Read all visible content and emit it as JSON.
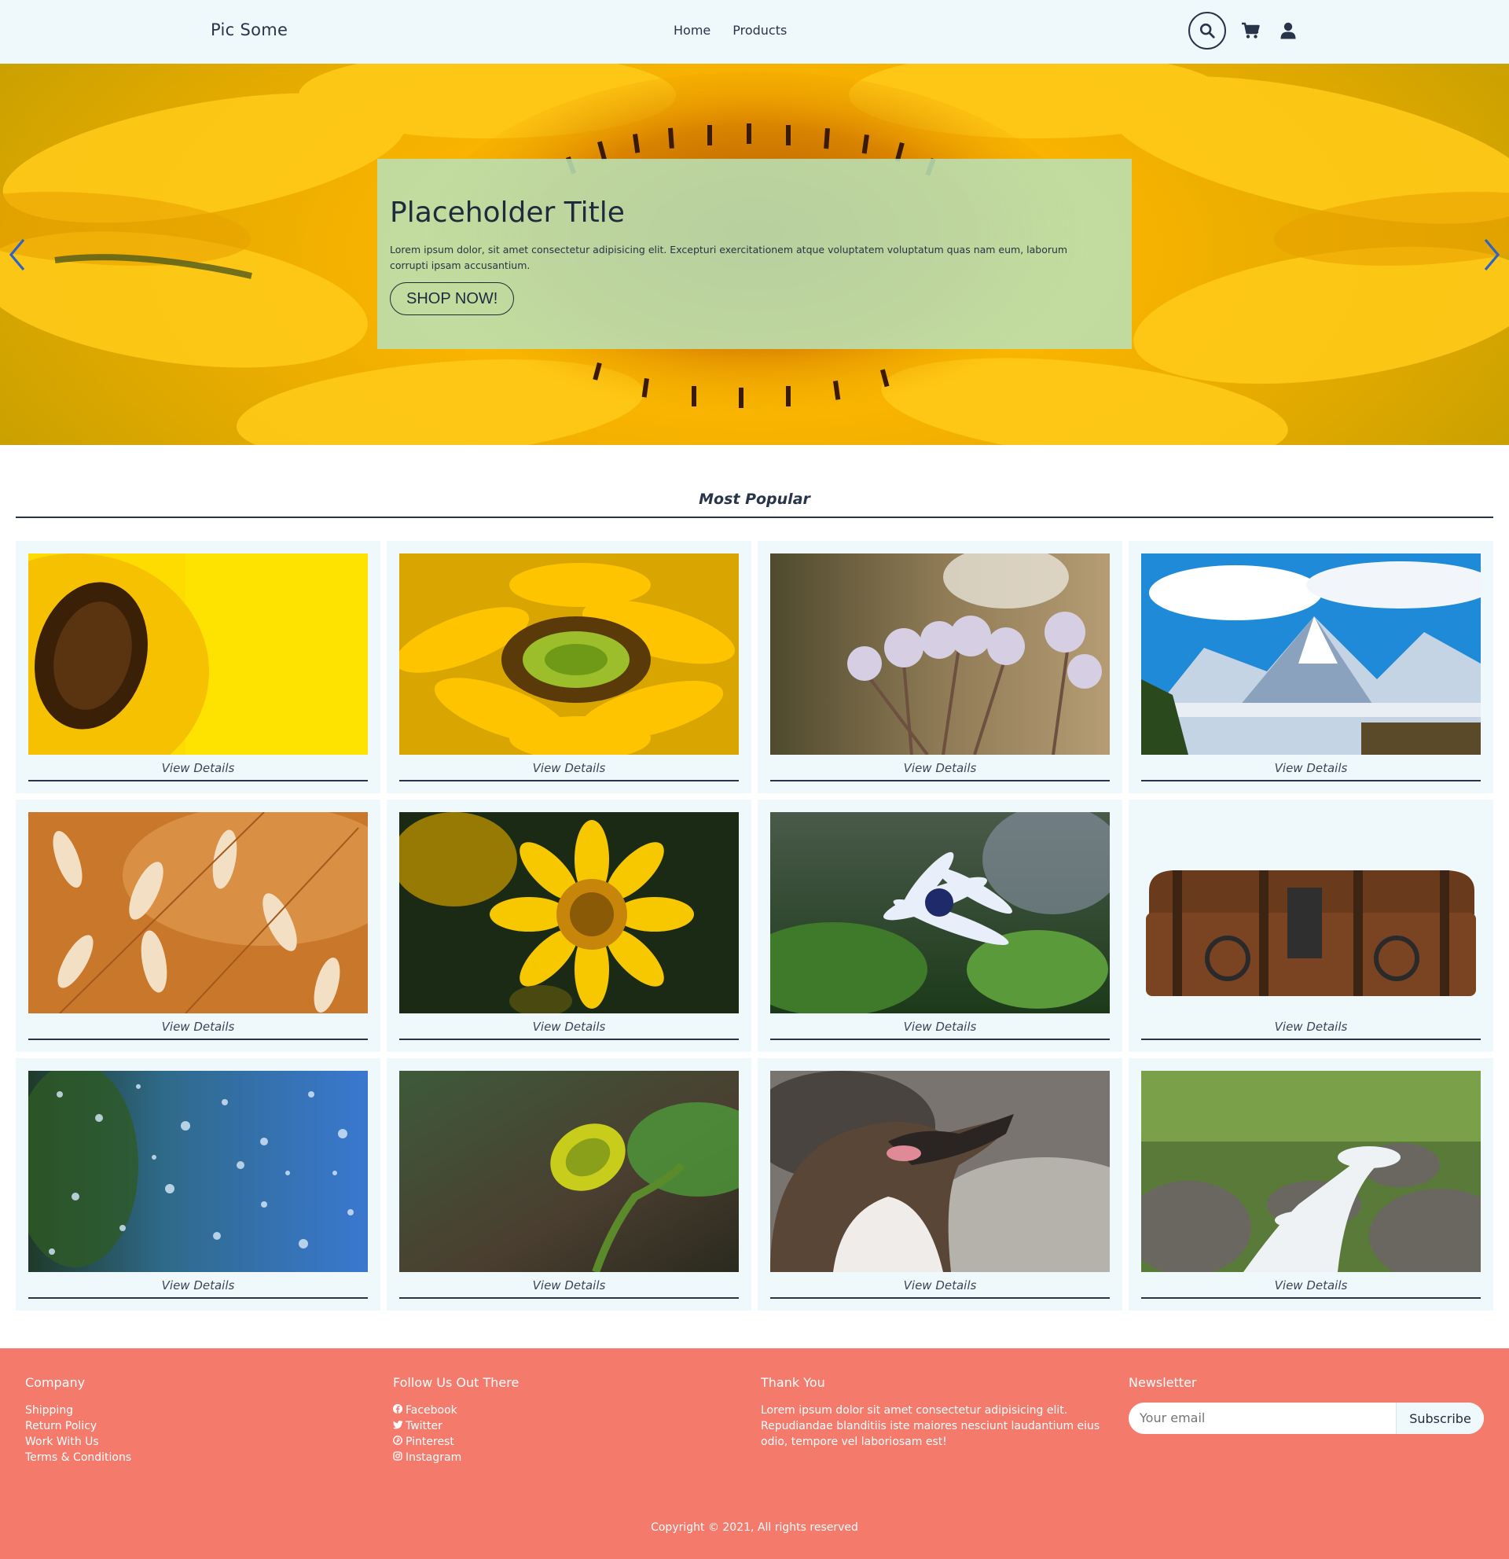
{
  "header": {
    "brand": "Pic Some",
    "nav": [
      {
        "label": "Home"
      },
      {
        "label": "Products"
      }
    ],
    "icons": [
      "search-icon",
      "cart-icon",
      "user-icon"
    ]
  },
  "hero": {
    "title": "Placeholder Title",
    "text": "Lorem ipsum dolor, sit amet consectetur adipisicing elit. Excepturi exercitationem atque voluptatem voluptatum quas nam eum, laborum corrupti ipsam accusantium.",
    "button": "SHOP NOW!",
    "prev_icon": "chevron-left-icon",
    "next_icon": "chevron-right-icon"
  },
  "popular": {
    "title": "Most Popular",
    "items": [
      {
        "subject": "sunflower-closeup",
        "link": "View Details"
      },
      {
        "subject": "sunflower",
        "link": "View Details"
      },
      {
        "subject": "frosted-wildflowers",
        "link": "View Details"
      },
      {
        "subject": "snowy-mountains",
        "link": "View Details"
      },
      {
        "subject": "grass-seed-heads",
        "link": "View Details"
      },
      {
        "subject": "yellow-daisy",
        "link": "View Details"
      },
      {
        "subject": "white-daisy",
        "link": "View Details"
      },
      {
        "subject": "wooden-chest",
        "link": "View Details"
      },
      {
        "subject": "raindrops-on-glass",
        "link": "View Details"
      },
      {
        "subject": "flower-bud",
        "link": "View Details"
      },
      {
        "subject": "penguin",
        "link": "View Details"
      },
      {
        "subject": "mountain-stream",
        "link": "View Details"
      }
    ]
  },
  "footer": {
    "company": {
      "title": "Company",
      "links": [
        "Shipping",
        "Return Policy",
        "Work With Us",
        "Terms & Conditions"
      ]
    },
    "follow": {
      "title": "Follow Us Out There",
      "links": [
        {
          "label": "Facebook",
          "icon": "facebook-icon"
        },
        {
          "label": "Twitter",
          "icon": "twitter-icon"
        },
        {
          "label": "Pinterest",
          "icon": "pinterest-icon"
        },
        {
          "label": "Instagram",
          "icon": "instagram-icon"
        }
      ]
    },
    "thanks": {
      "title": "Thank You",
      "text": "Lorem ipsum dolor sit amet consectetur adipisicing elit. Repudiandae blanditiis iste maiores nesciunt laudantium eius odio, tempore vel laboriosam est!"
    },
    "newsletter": {
      "title": "Newsletter",
      "placeholder": "Your email",
      "button": "Subscribe"
    },
    "copyright": "Copyright © 2021, All rights reserved"
  },
  "colors": {
    "header_bg": "#eff9fc",
    "text_dark": "#28344a",
    "footer_bg": "#f47a6c",
    "hero_overlay": "#bae0b4",
    "card_bg": "#eff9fc"
  }
}
